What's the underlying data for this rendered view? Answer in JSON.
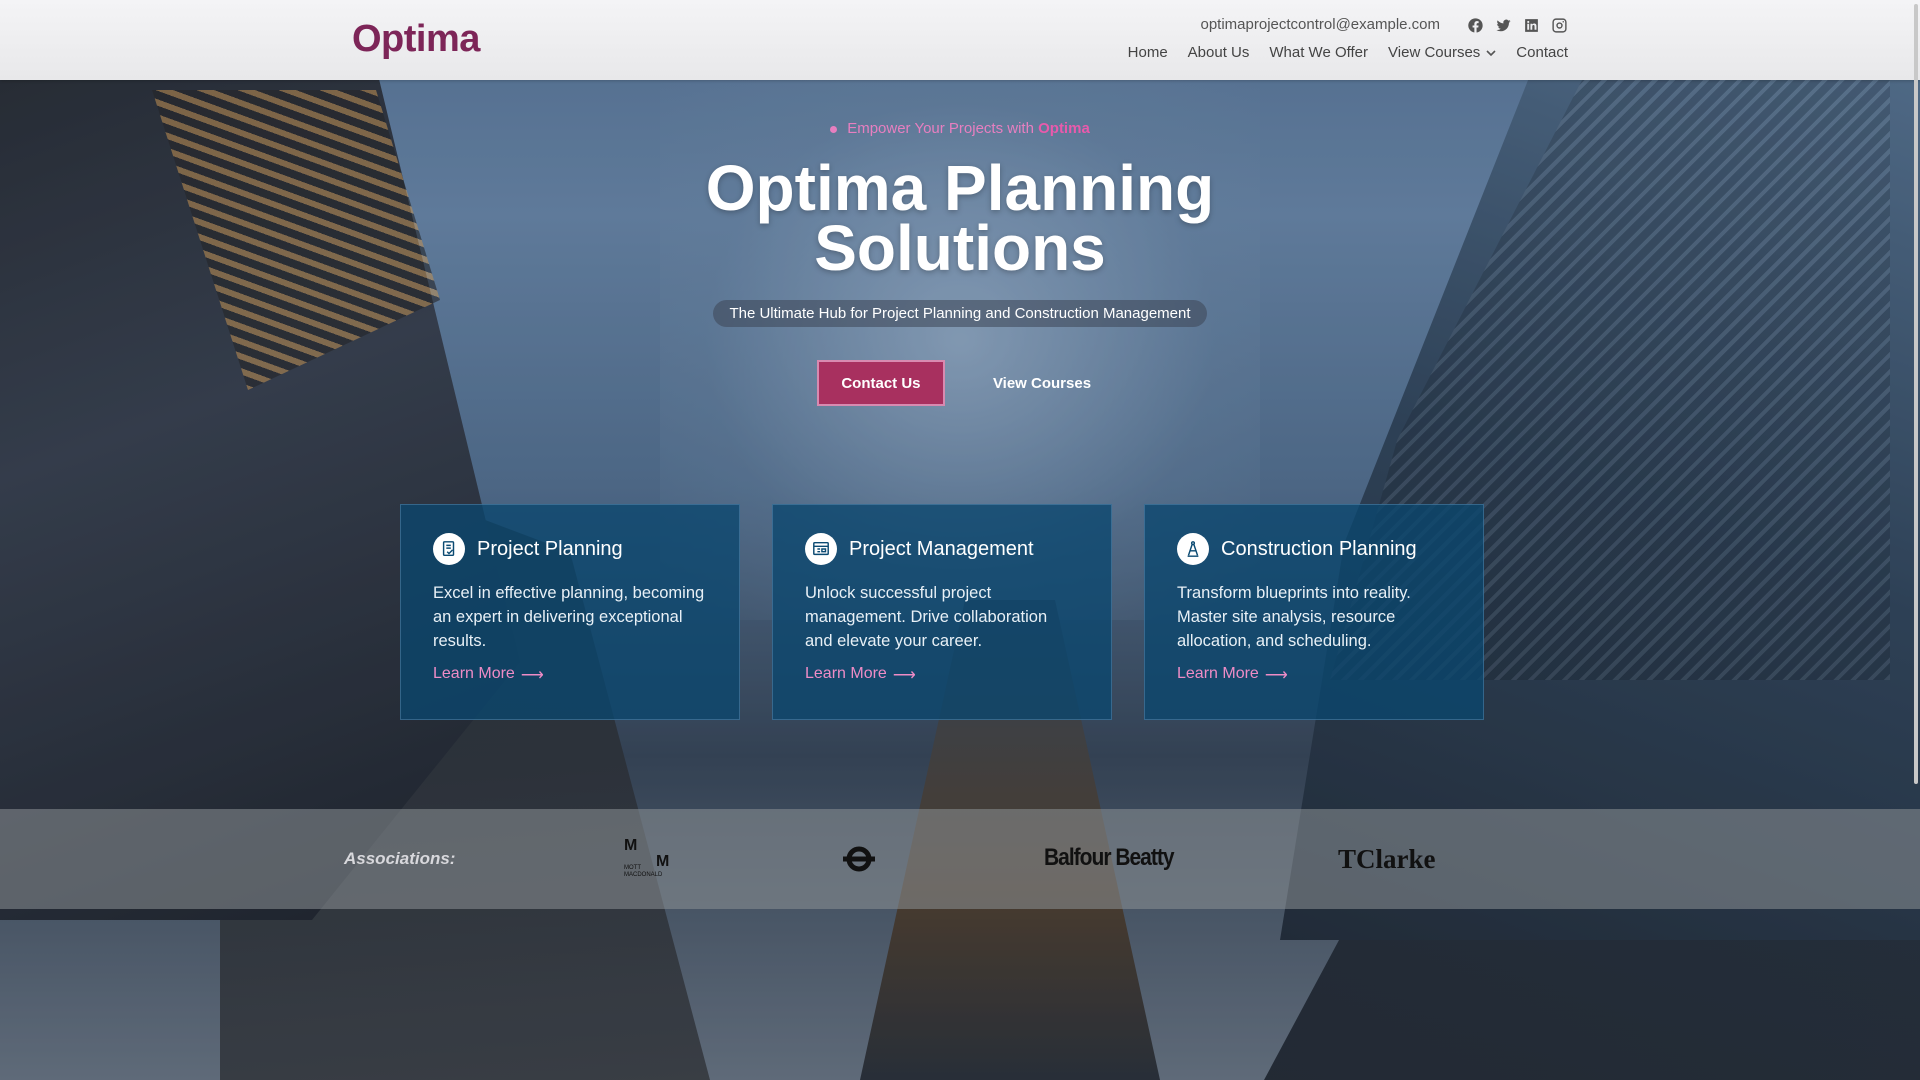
{
  "brand": {
    "name": "Optima",
    "color": "#7d2558",
    "accent": "#e77fc0"
  },
  "header": {
    "email": "optimaprojectcontrol@example.com",
    "socials": [
      "facebook-icon",
      "twitter-icon",
      "linkedin-icon",
      "instagram-icon"
    ],
    "nav": {
      "home": "Home",
      "about": "About Us",
      "offer": "What We Offer",
      "courses": "View Courses",
      "contact": "Contact"
    }
  },
  "hero": {
    "tagline_prefix": "Empower Your Projects with ",
    "tagline_brand": "Optima",
    "title_line1": "Optima Planning",
    "title_line2": "Solutions",
    "subtitle": "The Ultimate Hub for Project Planning and Construction Management",
    "cta_contact": "Contact Us",
    "cta_courses": "View Courses"
  },
  "cards": [
    {
      "icon": "document-check-icon",
      "title": "Project Planning",
      "desc": "Excel in effective planning, becoming an expert in delivering exceptional results.",
      "link": "Learn More",
      "arrow": "⟶"
    },
    {
      "icon": "board-icon",
      "title": "Project Management",
      "desc": "Unlock successful project management. Drive collaboration and elevate your career.",
      "link": "Learn More",
      "arrow": "⟶"
    },
    {
      "icon": "drafting-compass-icon",
      "title": "Construction Planning",
      "desc": "Transform blueprints into reality. Master site analysis, resource allocation, and scheduling.",
      "link": "Learn More",
      "arrow": "⟶"
    }
  ],
  "associations": {
    "label": "Associations:",
    "logos": {
      "mott_m1": "M",
      "mott_m2": "M",
      "mott_text": "MOTT MACDONALD",
      "tfl": "tfl-roundel-logo",
      "balfour": "Balfour Beatty",
      "tclarke": "TClarke"
    }
  }
}
